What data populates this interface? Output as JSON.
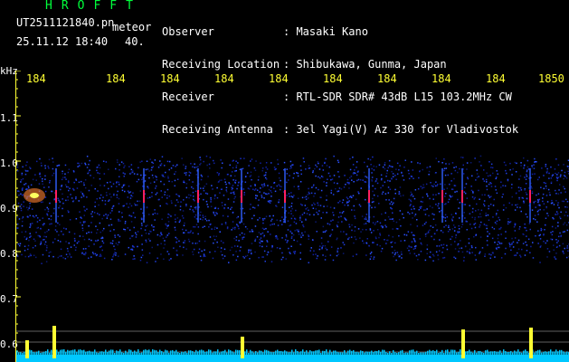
{
  "header": {
    "brand": "HROFFT",
    "filename": "UT2511121840.pn",
    "overlay_text": "meteor",
    "timestamp": "25.11.12 18:40",
    "minute_label": "40."
  },
  "info": {
    "labels": [
      "Observer",
      "Receiving Location",
      "Receiver",
      "Receiving Antenna"
    ],
    "values": [
      ": Masaki Kano",
      ": Shibukawa, Gunma, Japan",
      ": RTL-SDR SDR# 43dB L15 103.2MHz CW",
      ": 3el Yagi(V) Az 330 for Vladivostok"
    ]
  },
  "axes": {
    "y_unit": "kHz",
    "y_ticks": [
      "1.1",
      "1.0",
      "0.9",
      "0.8",
      "0.7",
      "0.6"
    ],
    "x_ticks": [
      "184",
      "184",
      "184",
      "184",
      "184",
      "184",
      "184",
      "184",
      "184",
      "1850"
    ]
  },
  "colors": {
    "header_green": "#00ff3c",
    "tick_yellow": "#ffff33",
    "text_white": "#ffffff",
    "background": "#000000",
    "noise_blue": "#1a2aa8",
    "signal_red": "#ff2060",
    "baseline_cyan": "#00c8ff"
  }
}
